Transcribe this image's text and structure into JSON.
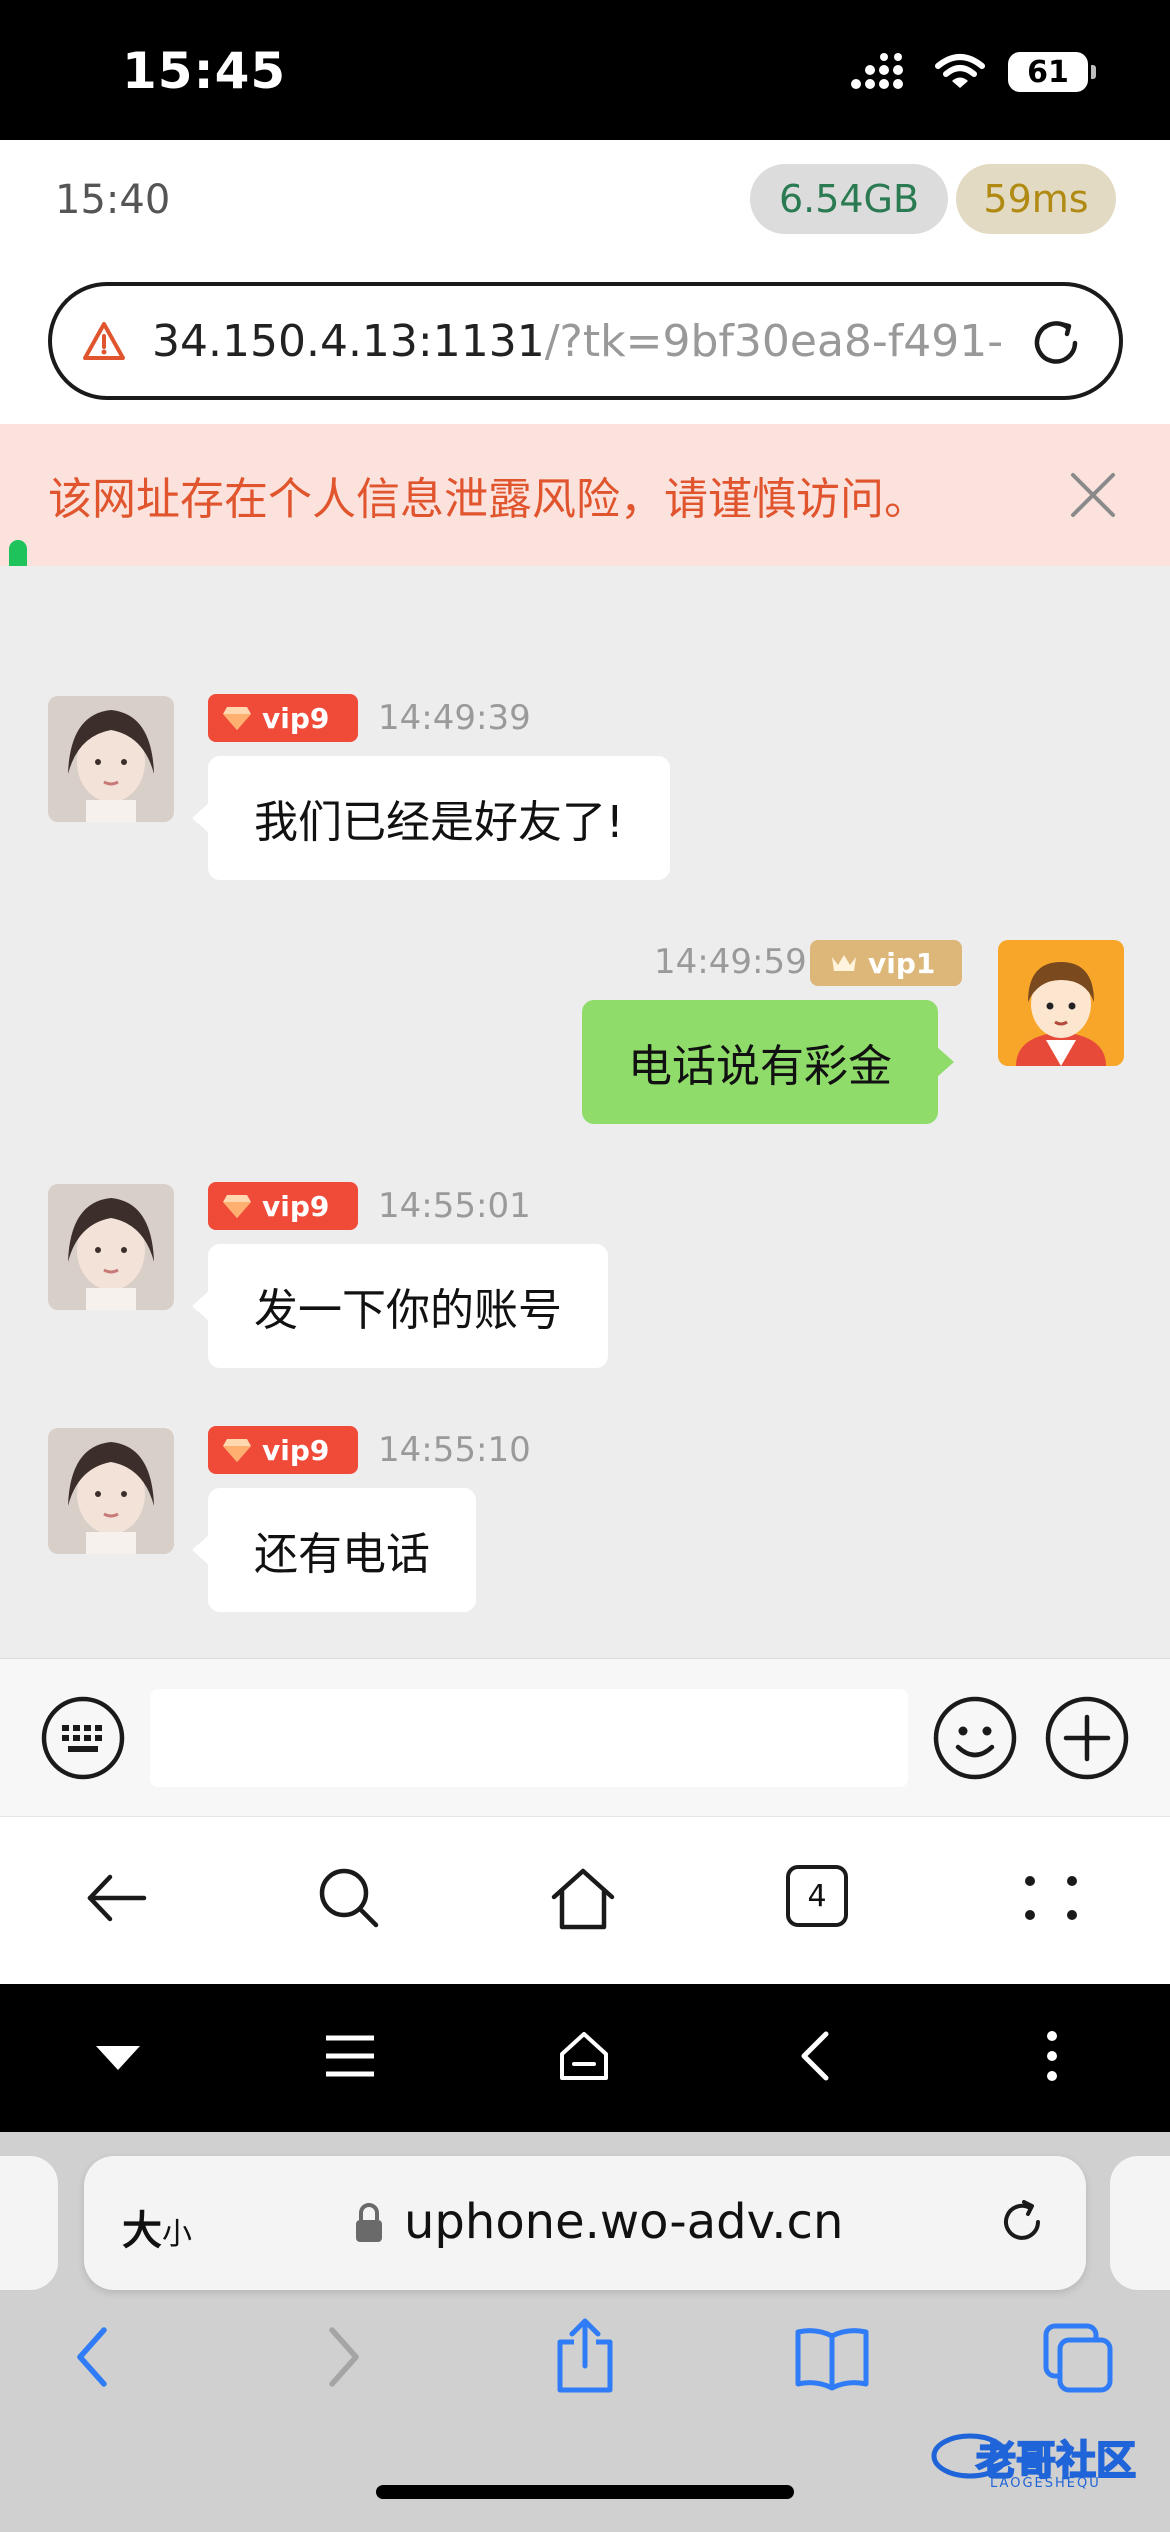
{
  "ios_status": {
    "time": "15:45",
    "battery": "61"
  },
  "inner_status": {
    "time": "15:40",
    "memory": "6.54GB",
    "latency": "59ms"
  },
  "url_bar": {
    "host": "34.150.4.13:1131",
    "path": "/?tk=9bf30ea8-f491-"
  },
  "warning": {
    "text": "该网址存在个人信息泄露风险，请谨慎访问。"
  },
  "messages": [
    {
      "side": "left",
      "vip": "vip9",
      "time": "14:49:39",
      "text": "我们已经是好友了!"
    },
    {
      "side": "right",
      "vip": "vip1",
      "time": "14:49:59",
      "text": "电话说有彩金"
    },
    {
      "side": "left",
      "vip": "vip9",
      "time": "14:55:01",
      "text": "发一下你的账号"
    },
    {
      "side": "left",
      "vip": "vip9",
      "time": "14:55:10",
      "text": "还有电话"
    }
  ],
  "input": {
    "value": "",
    "placeholder": ""
  },
  "browser_nav": {
    "tab_count": "4"
  },
  "safari": {
    "size_label_big": "大",
    "size_label_small": "小",
    "host": "uphone.wo-adv.cn"
  },
  "watermark": {
    "text": "老哥社区",
    "sub": "LAOGESHEQU"
  },
  "colors": {
    "vip9": "#f04a38",
    "vip1": "#ddb77a",
    "my_bubble": "#8fdc6a",
    "warning_text": "#e0552e",
    "accent_ios": "#2f7cf6"
  },
  "icons": [
    "signal-icon",
    "wifi-icon",
    "battery-icon",
    "warning-triangle-icon",
    "reload-icon",
    "close-icon",
    "keyboard-icon",
    "emoji-icon",
    "plus-icon",
    "back-arrow-icon",
    "search-icon",
    "home-icon",
    "tabs-icon",
    "more-icon",
    "collapse-icon",
    "menu-icon",
    "android-home-icon",
    "android-back-icon",
    "kebab-icon",
    "lock-icon",
    "share-icon",
    "bookmarks-icon",
    "tabs-overview-icon"
  ]
}
